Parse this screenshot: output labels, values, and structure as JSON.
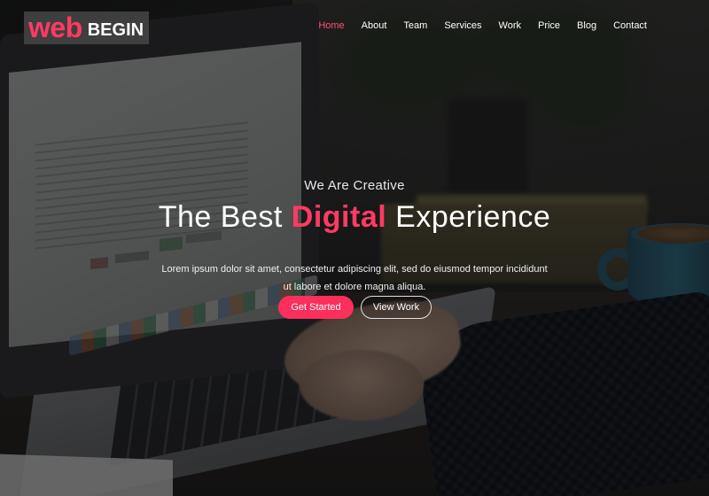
{
  "brand": {
    "logo_primary": "web",
    "logo_secondary": "BEGIN",
    "accent_color": "#ff3a63"
  },
  "nav": {
    "items": [
      {
        "label": "Home",
        "active": true
      },
      {
        "label": "About",
        "active": false
      },
      {
        "label": "Team",
        "active": false
      },
      {
        "label": "Services",
        "active": false
      },
      {
        "label": "Work",
        "active": false
      },
      {
        "label": "Price",
        "active": false
      },
      {
        "label": "Blog",
        "active": false
      },
      {
        "label": "Contact",
        "active": false
      }
    ]
  },
  "hero": {
    "kicker": "We Are Creative",
    "headline_before": "The Best",
    "headline_accent": "Digital",
    "headline_after": "Experience",
    "description": "Lorem ipsum dolor sit amet, consectetur adipiscing elit, sed do eiusmod tempor incididunt ut labore et dolore magna aliqua.",
    "primary_button": "Get Started",
    "secondary_button": "View Work"
  }
}
